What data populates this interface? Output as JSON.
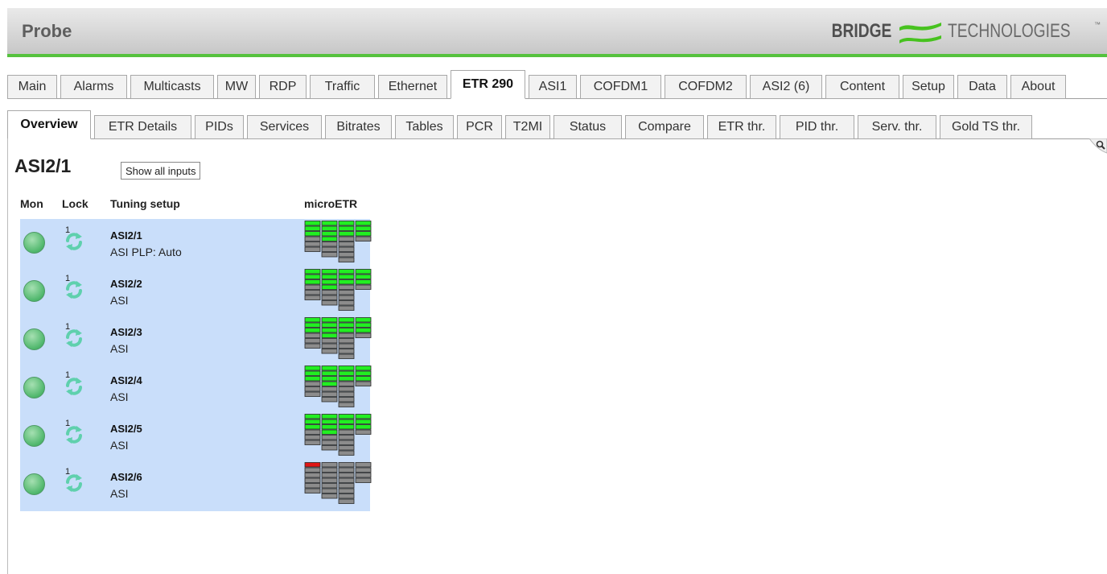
{
  "header": {
    "title": "Probe",
    "brand_left": "BRIDGE",
    "brand_right": "TECHNOLOGIES",
    "brand_tm": "™"
  },
  "main_tabs": [
    {
      "label": "Main"
    },
    {
      "label": "Alarms"
    },
    {
      "label": "Multicasts"
    },
    {
      "label": "MW"
    },
    {
      "label": "RDP"
    },
    {
      "label": "Traffic"
    },
    {
      "label": "Ethernet"
    },
    {
      "label": "ETR 290",
      "active": true
    },
    {
      "label": "ASI1"
    },
    {
      "label": "COFDM1"
    },
    {
      "label": "COFDM2"
    },
    {
      "label": "ASI2 (6)"
    },
    {
      "label": "Content"
    },
    {
      "label": "Setup"
    },
    {
      "label": "Data"
    },
    {
      "label": "About"
    }
  ],
  "sub_tabs": [
    {
      "label": "Overview",
      "active": true
    },
    {
      "label": "ETR Details"
    },
    {
      "label": "PIDs"
    },
    {
      "label": "Services"
    },
    {
      "label": "Bitrates"
    },
    {
      "label": "Tables"
    },
    {
      "label": "PCR"
    },
    {
      "label": "T2MI"
    },
    {
      "label": "Status"
    },
    {
      "label": "Compare"
    },
    {
      "label": "ETR thr."
    },
    {
      "label": "PID thr."
    },
    {
      "label": "Serv. thr."
    },
    {
      "label": "Gold TS thr."
    }
  ],
  "page": {
    "title": "ASI2/1",
    "show_all_label": "Show all inputs"
  },
  "table": {
    "headers": {
      "mon": "Mon",
      "lock": "Lock",
      "tuning": "Tuning setup",
      "metr": "microETR"
    },
    "rows": [
      {
        "name": "ASI2/1",
        "type": "ASI PLP: Auto",
        "lock": "1",
        "status": "ok"
      },
      {
        "name": "ASI2/2",
        "type": "ASI",
        "lock": "1",
        "status": "ok"
      },
      {
        "name": "ASI2/3",
        "type": "ASI",
        "lock": "1",
        "status": "ok"
      },
      {
        "name": "ASI2/4",
        "type": "ASI",
        "lock": "1",
        "status": "ok"
      },
      {
        "name": "ASI2/5",
        "type": "ASI",
        "lock": "1",
        "status": "ok"
      },
      {
        "name": "ASI2/6",
        "type": "ASI",
        "lock": "1",
        "status": "error"
      }
    ]
  },
  "colors": {
    "accent_green": "#56c23e",
    "led_green": "#4fb76c",
    "table_bg": "#c9defa",
    "cell_ok": "#22ee22",
    "cell_idle": "#8c8c8c",
    "cell_error": "#e01515"
  },
  "icons": {
    "lock": "refresh-icon",
    "search": "search-icon",
    "logo": "bridge-logo-icon"
  }
}
